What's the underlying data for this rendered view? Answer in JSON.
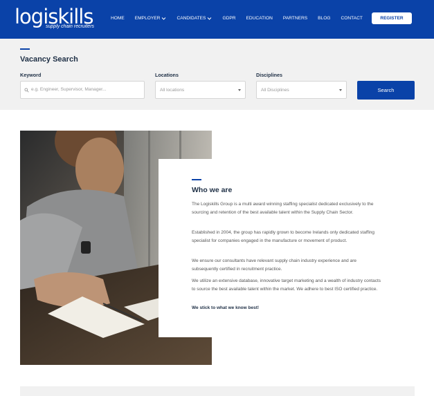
{
  "brand": {
    "logo_text": "logiskills",
    "tagline": "supply chain recruiters",
    "primary_color": "#0a42a8"
  },
  "nav": {
    "items": [
      {
        "label": "HOME",
        "dropdown": false
      },
      {
        "label": "EMPLOYER",
        "dropdown": true
      },
      {
        "label": "CANDIDATES",
        "dropdown": true
      },
      {
        "label": "GDPR",
        "dropdown": false
      },
      {
        "label": "EDUCATION",
        "dropdown": false
      },
      {
        "label": "PARTNERS",
        "dropdown": false
      },
      {
        "label": "BLOG",
        "dropdown": false
      },
      {
        "label": "CONTACT",
        "dropdown": false
      }
    ],
    "register_label": "REGISTER"
  },
  "vacancy_search": {
    "title": "Vacancy Search",
    "keyword": {
      "label": "Keyword",
      "value": "",
      "placeholder": "e.g. Engineer, Supervisor, Manager..."
    },
    "locations": {
      "label": "Locations",
      "selected": "All locations"
    },
    "disciplines": {
      "label": "Disciplines",
      "selected": "All Disciplines"
    },
    "search_label": "Search"
  },
  "about": {
    "title": "Who we are",
    "paragraphs": [
      "The Logiskills Group is a multi award winning staffing specialist dedicated exclusively to the sourcing and retention of the best available talent within the Supply Chain Sector.",
      "Established in 2004, the group has rapidly grown to become Irelands only dedicated staffing specialist for companies engaged in the manufacture or movement of product.",
      "We ensure our consultants have relevant supply chain industry experience and are subsequently certified in recruitment practice.",
      "We utilize an extensive database, innovative target marketing and a wealth of industry contacts to source the best available talent within the market. We adhere to best ISO certified practice."
    ],
    "tagline": "We stick to what we know best!"
  }
}
